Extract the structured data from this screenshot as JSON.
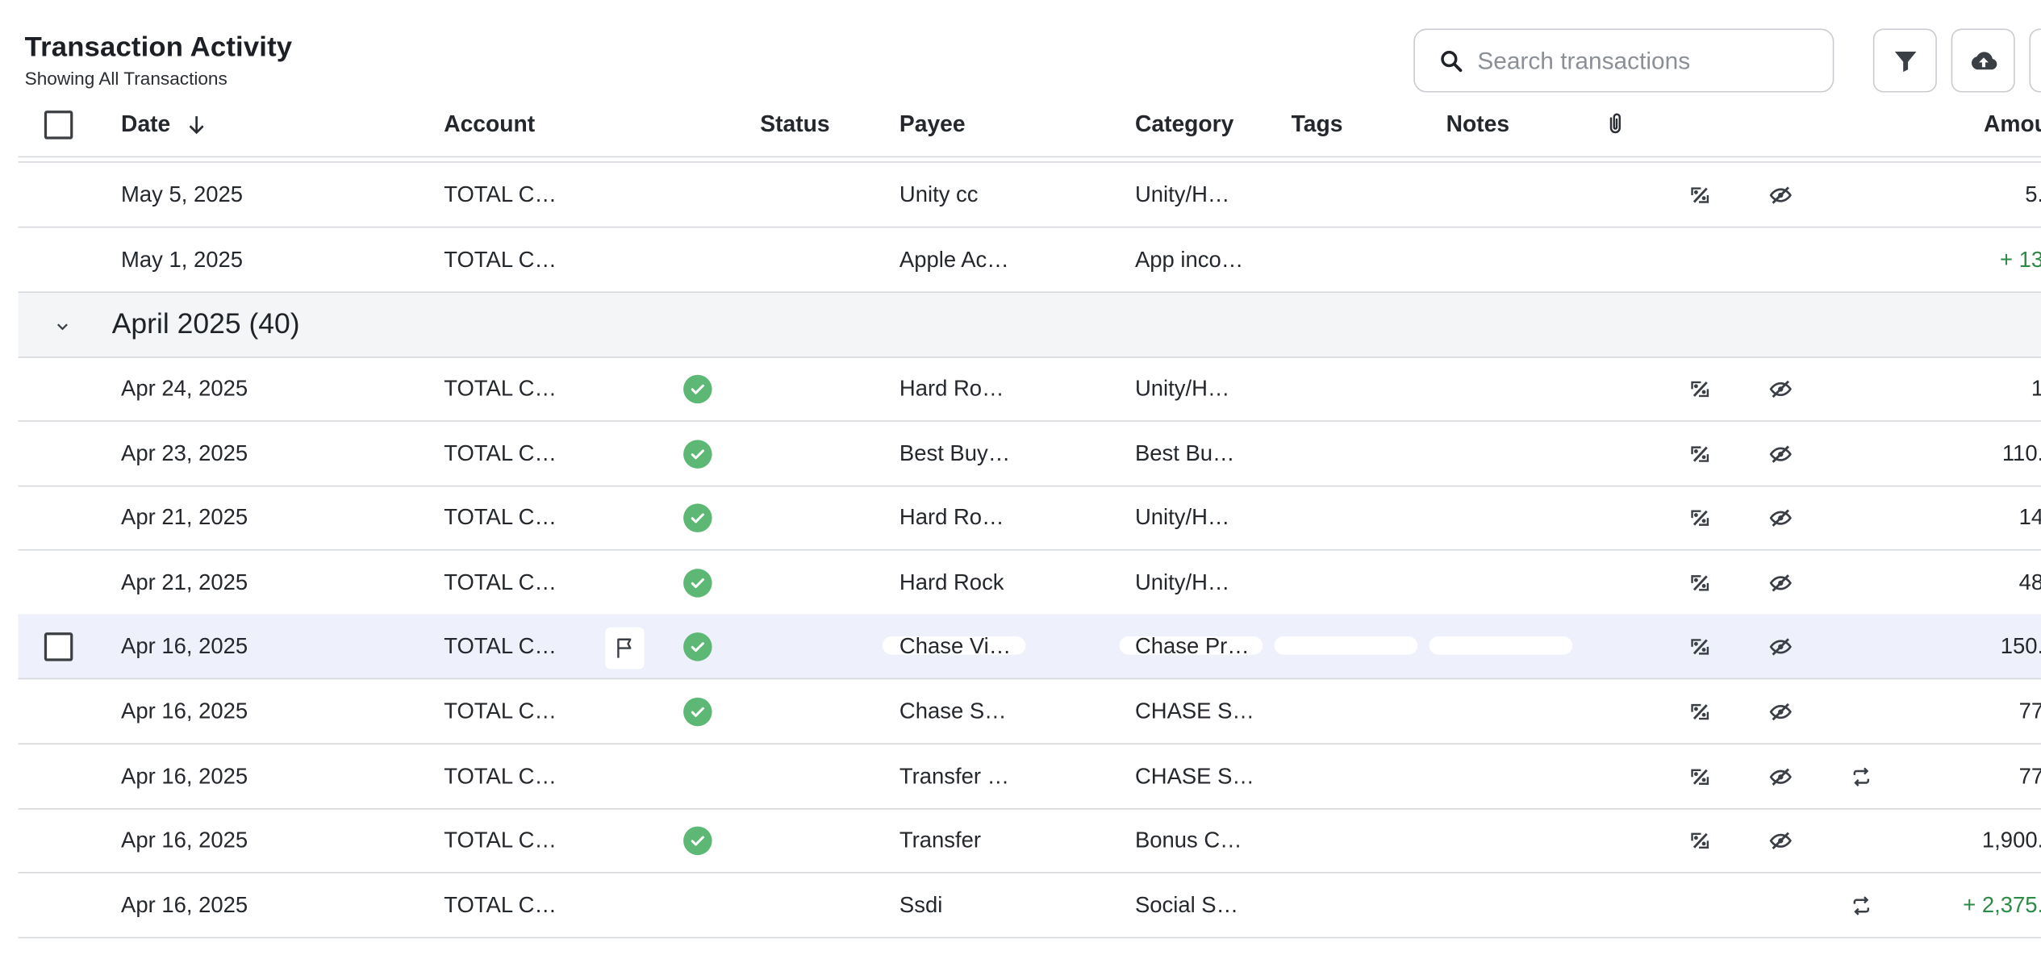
{
  "page": {
    "title": "Transaction Activity",
    "subtitle": "Showing All Transactions"
  },
  "search": {
    "placeholder": "Search transactions",
    "value": ""
  },
  "toolbar": {
    "filter_icon": "filter-icon",
    "upload_icon": "cloud-upload-icon"
  },
  "columns": {
    "date": "Date",
    "account": "Account",
    "status": "Status",
    "payee": "Payee",
    "category": "Category",
    "tags": "Tags",
    "notes": "Notes",
    "amount": "Amou"
  },
  "colors": {
    "status_ok": "#5cb874",
    "positive_amount": "#2e8b46",
    "group_bg": "#f4f5f7",
    "selected_bg": "#eef0fb"
  },
  "rows_top": [
    {
      "date": "May 5, 2025",
      "account": "TOTAL C…",
      "payee": "Unity cc",
      "category": "Unity/H…",
      "amount": "5.",
      "positive": false,
      "status": false,
      "split": true,
      "hide": true,
      "recurring": false
    },
    {
      "date": "May 1, 2025",
      "account": "TOTAL C…",
      "payee": "Apple Ac…",
      "category": "App inco…",
      "amount": "+ 13",
      "positive": true,
      "status": false,
      "split": false,
      "hide": false,
      "recurring": false
    }
  ],
  "group": {
    "label": "April 2025 (40)"
  },
  "rows_april": [
    {
      "date": "Apr 24, 2025",
      "account": "TOTAL C…",
      "payee": "Hard Ro…",
      "category": "Unity/H…",
      "amount": "1",
      "positive": false
    },
    {
      "date": "Apr 23, 2025",
      "account": "TOTAL C…",
      "payee": "Best Buy…",
      "category": "Best Bu…",
      "amount": "110.",
      "positive": false
    },
    {
      "date": "Apr 21, 2025",
      "account": "TOTAL C…",
      "payee": "Hard Ro…",
      "category": "Unity/H…",
      "amount": "14",
      "positive": false
    },
    {
      "date": "Apr 21, 2025",
      "account": "TOTAL C…",
      "payee": "Hard Rock",
      "category": "Unity/H…",
      "amount": "48",
      "positive": false
    },
    {
      "date": "Apr 16, 2025",
      "account": "TOTAL C…",
      "payee": "Chase Vi…",
      "category": "Chase Pr…",
      "amount": "150.",
      "positive": false
    },
    {
      "date": "Apr 16, 2025",
      "account": "TOTAL C…",
      "payee": "Chase S…",
      "category": "CHASE S…",
      "amount": "77",
      "positive": false
    },
    {
      "date": "Apr 16, 2025",
      "account": "TOTAL C…",
      "payee": "Transfer …",
      "category": "CHASE S…",
      "amount": "77",
      "positive": false
    },
    {
      "date": "Apr 16, 2025",
      "account": "TOTAL C…",
      "payee": "Transfer",
      "category": "Bonus C…",
      "amount": "1,900.",
      "positive": false
    },
    {
      "date": "Apr 16, 2025",
      "account": "TOTAL C…",
      "payee": "Ssdi",
      "category": "Social S…",
      "amount": "+ 2,375.",
      "positive": true
    }
  ]
}
